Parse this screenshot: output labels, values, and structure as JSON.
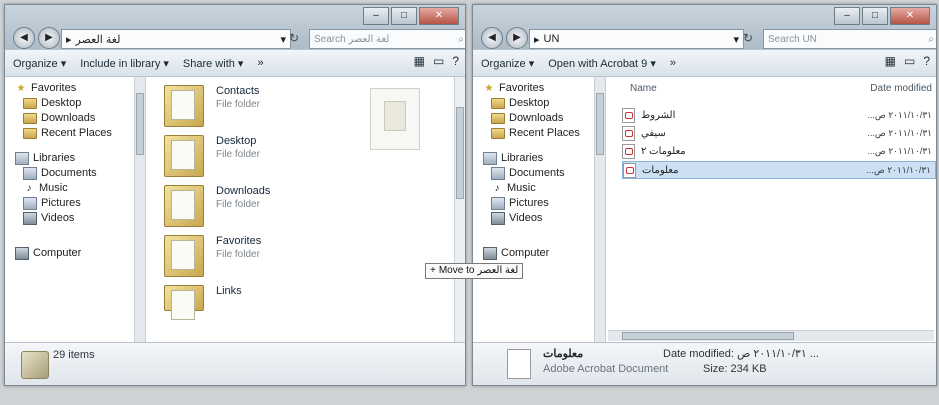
{
  "window1": {
    "address_path": "لغة العصر",
    "search_placeholder": "Search لغة العصر",
    "toolbar": {
      "organize": "Organize ▾",
      "include_library": "Include in library ▾",
      "share_with": "Share with ▾",
      "more": "»"
    },
    "nav": {
      "favorites": "Favorites",
      "desktop": "Desktop",
      "downloads": "Downloads",
      "recent_places": "Recent Places",
      "libraries": "Libraries",
      "documents": "Documents",
      "music": "Music",
      "pictures": "Pictures",
      "videos": "Videos",
      "computer": "Computer"
    },
    "items": [
      {
        "name": "Contacts",
        "type": "File folder"
      },
      {
        "name": "Desktop",
        "type": "File folder"
      },
      {
        "name": "Downloads",
        "type": "File folder"
      },
      {
        "name": "Favorites",
        "type": "File folder"
      },
      {
        "name": "Links",
        "type": ""
      }
    ],
    "status_count": "29 items"
  },
  "window2": {
    "address_path": "UN",
    "search_placeholder": "Search UN",
    "toolbar": {
      "organize": "Organize ▾",
      "open_with": "Open with Acrobat 9 ▾",
      "more": "»"
    },
    "nav": {
      "favorites": "Favorites",
      "desktop": "Desktop",
      "downloads": "Downloads",
      "recent_places": "Recent Places",
      "libraries": "Libraries",
      "documents": "Documents",
      "music": "Music",
      "pictures": "Pictures",
      "videos": "Videos",
      "computer": "Computer"
    },
    "columns": {
      "name": "Name",
      "date_modified": "Date modified"
    },
    "files": [
      {
        "name": "الشروط",
        "date": "٢٠١١/١٠/٣١ ص..."
      },
      {
        "name": "سيفي",
        "date": "٢٠١١/١٠/٣١ ص..."
      },
      {
        "name": "معلومات ٢",
        "date": "٢٠١١/١٠/٣١ ص..."
      },
      {
        "name": "معلومات",
        "date": "٢٠١١/١٠/٣١ ص..."
      }
    ],
    "details": {
      "name": "معلومات",
      "type": "Adobe Acrobat Document",
      "date_modified": "Date modified: ٢٠١١/١٠/٣١ ص ...",
      "size": "Size: 234 KB"
    }
  },
  "drag_tooltip": {
    "text": "Move to",
    "target": "لغة العصر"
  }
}
